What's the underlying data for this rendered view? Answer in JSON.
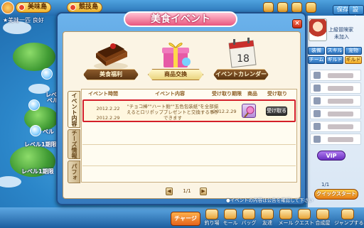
{
  "top": {
    "tabs": [
      "美味島",
      "競技島"
    ],
    "status": "★美味一匹 良好",
    "buttons": [
      "保存",
      "設定"
    ]
  },
  "map": {
    "labels": [
      "レベル",
      "ベル",
      "ベル",
      "レベル1期限",
      "レベル1期限"
    ]
  },
  "side": {
    "name": "上級冒険家",
    "sub": "未加入",
    "tabs": [
      "装備",
      "スキル",
      "宠物",
      "チーム",
      "ギルド",
      "ギルド"
    ],
    "page": "1/1",
    "vip": "VIP"
  },
  "quick_start": "クイックスタート",
  "chat_button": "チャージ",
  "bottom_items": [
    "釣り場",
    "モール",
    "バッグ",
    "友達",
    "メール",
    "クエスト",
    "合成屋",
    "ジャンプする"
  ],
  "window": {
    "title": "美食イベント",
    "close": "×",
    "cards": [
      {
        "label": "美食福利"
      },
      {
        "label": "商品交換"
      },
      {
        "label": "イベントカレンダー",
        "calendar_day": "18"
      }
    ],
    "vtabs": [
      "イベント内容",
      "チーズ情報",
      "パフォーマ交換"
    ],
    "columns": [
      "イベント時間",
      "イベント内容",
      "受け取り期限",
      "商品",
      "受け取り"
    ],
    "rows": [
      {
        "start": "2012.2.22",
        "end": "2012.2.29",
        "desc": "\"チョコ棒\"\"ハート飴\"\"五色包装紙\"を全部揃えるとロリポップブレゼントと交換する事ができます",
        "deadline": "2012.2.29",
        "button": "受け取る"
      }
    ],
    "pager": {
      "prev": "◀",
      "text": "1/1",
      "next": "▶"
    },
    "notice": "●イベントの内容は公告を確認して下さい"
  },
  "colors": {
    "highlight_border": "#d41f2a",
    "title_pink": "#e9567e",
    "window_blue": "#3579bd"
  }
}
